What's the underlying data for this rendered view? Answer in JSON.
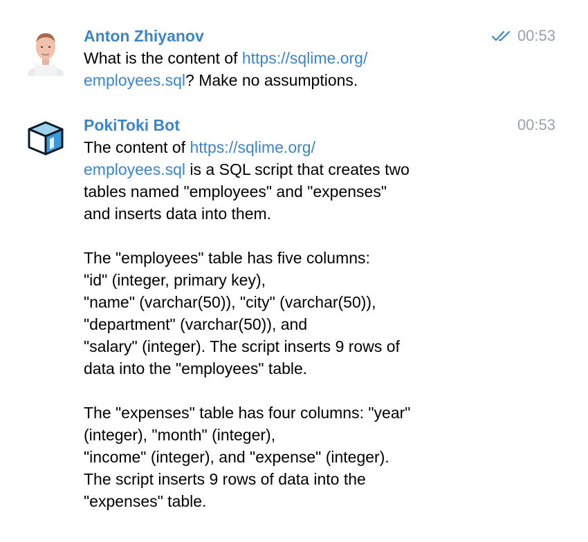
{
  "messages": {
    "user": {
      "sender": "Anton Zhiyanov",
      "time": "00:53",
      "status_icon": "double-check-icon",
      "text": {
        "l1_pre": "What is the content of ",
        "l1_link": "https://sqlime.org/",
        "l2_link": "employees.sql",
        "l2_post": "? Make no assumptions."
      }
    },
    "bot": {
      "sender": "PokiToki Bot",
      "time": "00:53",
      "text": {
        "l1_pre": "The content of ",
        "l1_link": "https://sqlime.org/",
        "l2_link": "employees.sql",
        "l2_post": " is a SQL script that creates two",
        "lines_a": [
          "tables named \"employees\" and \"expenses\"",
          "and inserts data into them."
        ],
        "lines_b": [
          "The \"employees\" table has five columns:",
          "\"id\" (integer, primary key),",
          "\"name\" (varchar(50)), \"city\" (varchar(50)),",
          "\"department\" (varchar(50)), and",
          "\"salary\" (integer). The script inserts 9 rows of",
          "data into the \"employees\" table."
        ],
        "lines_c": [
          "The \"expenses\" table has four columns: \"year\"",
          "(integer), \"month\" (integer),",
          "\"income\" (integer), and \"expense\" (integer).",
          "The script inserts 9 rows of data into the",
          "\"expenses\" table."
        ]
      }
    }
  },
  "colors": {
    "link": "#3a86c8",
    "sender": "#3a86c8",
    "time": "#9aa0a6",
    "check": "#3a86c8"
  }
}
